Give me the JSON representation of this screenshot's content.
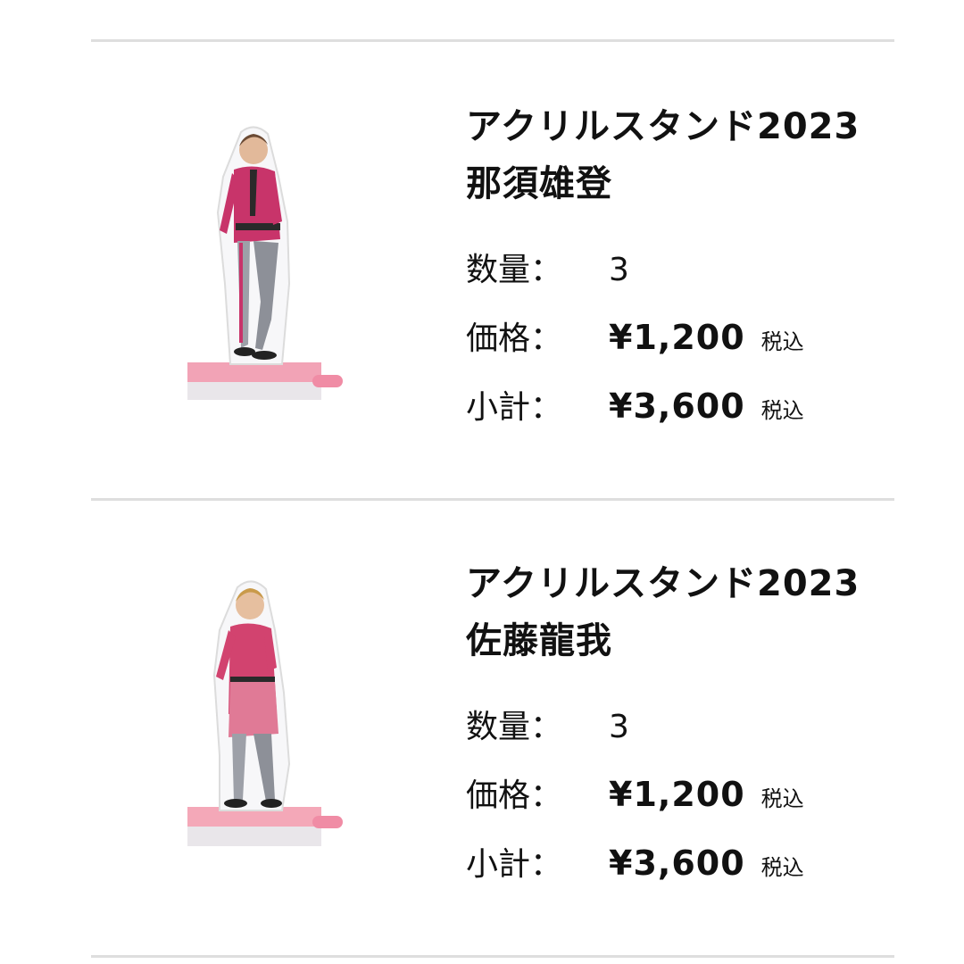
{
  "cart": {
    "items": [
      {
        "title_line1": "アクリルスタンド2023",
        "title_line2": "那須雄登",
        "quantity_label": "数量：",
        "quantity": "3",
        "price_label": "価格：",
        "price": "¥1,200",
        "price_tax": "税込",
        "subtotal_label": "小計：",
        "subtotal": "¥3,600",
        "subtotal_tax": "税込",
        "image": {
          "icon": "acrylic-stand-figure-image",
          "outfit_color": "#c8346a",
          "base_color": "#f2a3b6"
        }
      },
      {
        "title_line1": "アクリルスタンド2023",
        "title_line2": "佐藤龍我",
        "quantity_label": "数量：",
        "quantity": "3",
        "price_label": "価格：",
        "price": "¥1,200",
        "price_tax": "税込",
        "subtotal_label": "小計：",
        "subtotal": "¥3,600",
        "subtotal_tax": "税込",
        "image": {
          "icon": "acrylic-stand-figure-image",
          "outfit_color": "#d2436f",
          "base_color": "#f4a8b8"
        }
      }
    ]
  }
}
